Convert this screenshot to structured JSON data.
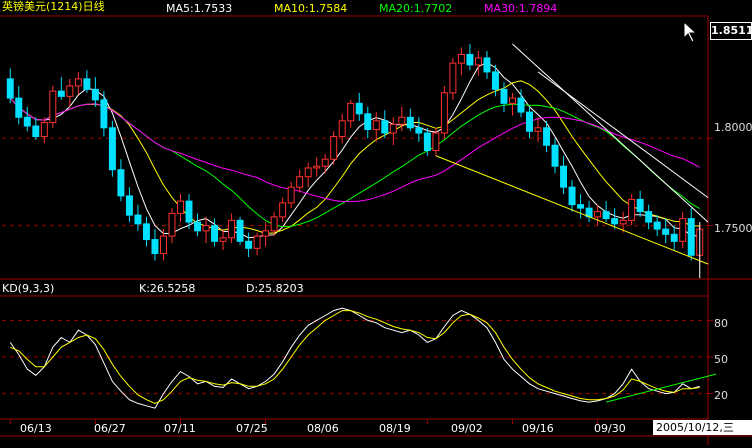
{
  "header": {
    "title": "英镑美元(1214)日线",
    "ma": [
      {
        "label": "MA5:1.7533",
        "color": "#ffffff"
      },
      {
        "label": "MA10:1.7584",
        "color": "#ffff00"
      },
      {
        "label": "MA20:1.7702",
        "color": "#00ff00"
      },
      {
        "label": "MA30:1.7894",
        "color": "#ff00ff"
      }
    ]
  },
  "price_axis": {
    "current": "1.8511",
    "ticks": [
      "1.8000",
      "1.7500"
    ]
  },
  "kd": {
    "title": "KD(9,3,3)",
    "k_label": "K:26.5258",
    "d_label": "D:25.8203",
    "ticks": [
      "80",
      "50",
      "20"
    ]
  },
  "x_axis": {
    "labels": [
      "06/13",
      "06/27",
      "07/11",
      "07/25",
      "08/06",
      "08/19",
      "09/02",
      "09/16",
      "09/30"
    ]
  },
  "date_box": "2005/10/12,三",
  "colors": {
    "up": "#ff3030",
    "down": "#00e0ff",
    "grid": "#a00000",
    "trend": "#ffff00",
    "kd_trend": "#00ff00"
  },
  "chart_data": [
    {
      "type": "candlestick",
      "title": "英镑美元(1214)日线",
      "x": [
        "06/13",
        "06/14",
        "06/15",
        "06/16",
        "06/17",
        "06/20",
        "06/21",
        "06/22",
        "06/23",
        "06/24",
        "06/27",
        "06/28",
        "06/29",
        "06/30",
        "07/01",
        "07/04",
        "07/05",
        "07/06",
        "07/07",
        "07/08",
        "07/11",
        "07/12",
        "07/13",
        "07/14",
        "07/15",
        "07/18",
        "07/19",
        "07/20",
        "07/21",
        "07/22",
        "07/25",
        "07/26",
        "07/27",
        "07/28",
        "07/29",
        "08/01",
        "08/02",
        "08/03",
        "08/04",
        "08/05",
        "08/08",
        "08/09",
        "08/10",
        "08/11",
        "08/12",
        "08/15",
        "08/16",
        "08/17",
        "08/18",
        "08/19",
        "08/22",
        "08/23",
        "08/24",
        "08/25",
        "08/26",
        "08/29",
        "08/30",
        "08/31",
        "09/01",
        "09/02",
        "09/05",
        "09/06",
        "09/07",
        "09/08",
        "09/09",
        "09/12",
        "09/13",
        "09/14",
        "09/15",
        "09/16",
        "09/19",
        "09/20",
        "09/21",
        "09/22",
        "09/23",
        "09/26",
        "09/27",
        "09/28",
        "09/29",
        "09/30",
        "10/03",
        "10/04",
        "10/05",
        "10/06",
        "10/07",
        "10/10",
        "10/11",
        "10/12"
      ],
      "ohlc": [
        [
          1.834,
          1.84,
          1.82,
          1.823
        ],
        [
          1.823,
          1.83,
          1.808,
          1.812
        ],
        [
          1.812,
          1.818,
          1.804,
          1.807
        ],
        [
          1.807,
          1.812,
          1.799,
          1.801
        ],
        [
          1.801,
          1.812,
          1.797,
          1.809
        ],
        [
          1.809,
          1.83,
          1.806,
          1.827
        ],
        [
          1.827,
          1.835,
          1.822,
          1.824
        ],
        [
          1.824,
          1.834,
          1.818,
          1.83
        ],
        [
          1.83,
          1.838,
          1.825,
          1.834
        ],
        [
          1.834,
          1.839,
          1.826,
          1.828
        ],
        [
          1.828,
          1.835,
          1.818,
          1.822
        ],
        [
          1.822,
          1.827,
          1.801,
          1.806
        ],
        [
          1.806,
          1.81,
          1.778,
          1.782
        ],
        [
          1.782,
          1.788,
          1.764,
          1.767
        ],
        [
          1.767,
          1.772,
          1.752,
          1.756
        ],
        [
          1.756,
          1.762,
          1.747,
          1.751
        ],
        [
          1.751,
          1.755,
          1.738,
          1.742
        ],
        [
          1.742,
          1.748,
          1.73,
          1.734
        ],
        [
          1.734,
          1.748,
          1.73,
          1.744
        ],
        [
          1.744,
          1.76,
          1.74,
          1.757
        ],
        [
          1.757,
          1.768,
          1.752,
          1.764
        ],
        [
          1.764,
          1.768,
          1.748,
          1.752
        ],
        [
          1.752,
          1.757,
          1.744,
          1.747
        ],
        [
          1.747,
          1.755,
          1.74,
          1.75
        ],
        [
          1.75,
          1.754,
          1.738,
          1.741
        ],
        [
          1.741,
          1.748,
          1.736,
          1.743
        ],
        [
          1.743,
          1.757,
          1.74,
          1.753
        ],
        [
          1.753,
          1.755,
          1.739,
          1.741
        ],
        [
          1.741,
          1.746,
          1.732,
          1.737
        ],
        [
          1.737,
          1.746,
          1.733,
          1.744
        ],
        [
          1.744,
          1.752,
          1.738,
          1.747
        ],
        [
          1.747,
          1.758,
          1.744,
          1.755
        ],
        [
          1.755,
          1.766,
          1.752,
          1.763
        ],
        [
          1.763,
          1.775,
          1.76,
          1.772
        ],
        [
          1.772,
          1.782,
          1.769,
          1.778
        ],
        [
          1.778,
          1.786,
          1.772,
          1.783
        ],
        [
          1.783,
          1.789,
          1.778,
          1.784
        ],
        [
          1.784,
          1.791,
          1.78,
          1.788
        ],
        [
          1.788,
          1.804,
          1.785,
          1.801
        ],
        [
          1.801,
          1.814,
          1.797,
          1.81
        ],
        [
          1.81,
          1.822,
          1.806,
          1.82
        ],
        [
          1.82,
          1.826,
          1.81,
          1.814
        ],
        [
          1.814,
          1.818,
          1.8,
          1.805
        ],
        [
          1.805,
          1.815,
          1.798,
          1.81
        ],
        [
          1.81,
          1.816,
          1.8,
          1.803
        ],
        [
          1.803,
          1.812,
          1.796,
          1.808
        ],
        [
          1.808,
          1.818,
          1.804,
          1.812
        ],
        [
          1.812,
          1.817,
          1.804,
          1.806
        ],
        [
          1.806,
          1.812,
          1.798,
          1.803
        ],
        [
          1.803,
          1.806,
          1.79,
          1.793
        ],
        [
          1.793,
          1.806,
          1.79,
          1.803
        ],
        [
          1.803,
          1.83,
          1.8,
          1.826
        ],
        [
          1.826,
          1.846,
          1.822,
          1.843
        ],
        [
          1.843,
          1.852,
          1.836,
          1.848
        ],
        [
          1.848,
          1.854,
          1.839,
          1.842
        ],
        [
          1.842,
          1.85,
          1.836,
          1.846
        ],
        [
          1.846,
          1.85,
          1.834,
          1.838
        ],
        [
          1.838,
          1.842,
          1.824,
          1.828
        ],
        [
          1.828,
          1.832,
          1.815,
          1.82
        ],
        [
          1.82,
          1.826,
          1.813,
          1.823
        ],
        [
          1.823,
          1.828,
          1.812,
          1.815
        ],
        [
          1.815,
          1.818,
          1.8,
          1.804
        ],
        [
          1.804,
          1.812,
          1.798,
          1.806
        ],
        [
          1.806,
          1.81,
          1.792,
          1.796
        ],
        [
          1.796,
          1.8,
          1.78,
          1.784
        ],
        [
          1.784,
          1.79,
          1.768,
          1.772
        ],
        [
          1.772,
          1.776,
          1.758,
          1.762
        ],
        [
          1.762,
          1.768,
          1.754,
          1.76
        ],
        [
          1.76,
          1.764,
          1.752,
          1.755
        ],
        [
          1.755,
          1.762,
          1.75,
          1.758
        ],
        [
          1.758,
          1.764,
          1.752,
          1.754
        ],
        [
          1.754,
          1.76,
          1.748,
          1.751
        ],
        [
          1.751,
          1.758,
          1.746,
          1.753
        ],
        [
          1.753,
          1.768,
          1.75,
          1.765
        ],
        [
          1.765,
          1.77,
          1.755,
          1.758
        ],
        [
          1.758,
          1.762,
          1.748,
          1.752
        ],
        [
          1.752,
          1.756,
          1.744,
          1.748
        ],
        [
          1.748,
          1.754,
          1.74,
          1.745
        ],
        [
          1.745,
          1.75,
          1.736,
          1.741
        ],
        [
          1.741,
          1.758,
          1.737,
          1.754
        ],
        [
          1.754,
          1.76,
          1.73,
          1.733
        ],
        [
          1.733,
          1.75,
          1.728,
          1.748
        ]
      ],
      "ylim": [
        1.72,
        1.87
      ],
      "yticks": [
        1.8,
        1.75
      ],
      "grid": true,
      "series": [
        {
          "name": "MA5",
          "last": 1.7533
        },
        {
          "name": "MA10",
          "last": 1.7584
        },
        {
          "name": "MA20",
          "last": 1.7702
        },
        {
          "name": "MA30",
          "last": 1.7894
        }
      ]
    },
    {
      "type": "line",
      "title": "KD(9,3,3)",
      "ylim": [
        0,
        100
      ],
      "yticks": [
        80,
        50,
        20
      ],
      "grid": true,
      "series": [
        {
          "name": "K",
          "last": 26.5258,
          "values": [
            62,
            52,
            40,
            35,
            42,
            58,
            66,
            62,
            72,
            68,
            60,
            45,
            30,
            22,
            15,
            12,
            10,
            8,
            20,
            30,
            38,
            34,
            28,
            30,
            26,
            25,
            32,
            28,
            24,
            26,
            30,
            36,
            46,
            58,
            68,
            76,
            80,
            84,
            88,
            90,
            88,
            84,
            80,
            78,
            74,
            72,
            70,
            72,
            68,
            62,
            65,
            75,
            84,
            88,
            85,
            80,
            74,
            62,
            48,
            40,
            34,
            28,
            24,
            22,
            20,
            18,
            16,
            14,
            13,
            14,
            16,
            20,
            28,
            40,
            30,
            24,
            22,
            20,
            21,
            28,
            24,
            26
          ]
        },
        {
          "name": "D",
          "last": 25.8203,
          "values": [
            58,
            55,
            48,
            42,
            42,
            50,
            58,
            62,
            66,
            68,
            65,
            56,
            44,
            34,
            26,
            19,
            15,
            12,
            15,
            22,
            30,
            33,
            31,
            30,
            28,
            27,
            29,
            28,
            26,
            26,
            28,
            32,
            40,
            50,
            60,
            68,
            74,
            80,
            84,
            88,
            88,
            86,
            83,
            81,
            78,
            75,
            73,
            72,
            70,
            66,
            65,
            70,
            78,
            84,
            85,
            82,
            78,
            70,
            58,
            48,
            40,
            33,
            28,
            25,
            22,
            20,
            18,
            16,
            15,
            15,
            16,
            18,
            23,
            32,
            30,
            27,
            24,
            22,
            21,
            24,
            24,
            25
          ]
        }
      ]
    }
  ]
}
